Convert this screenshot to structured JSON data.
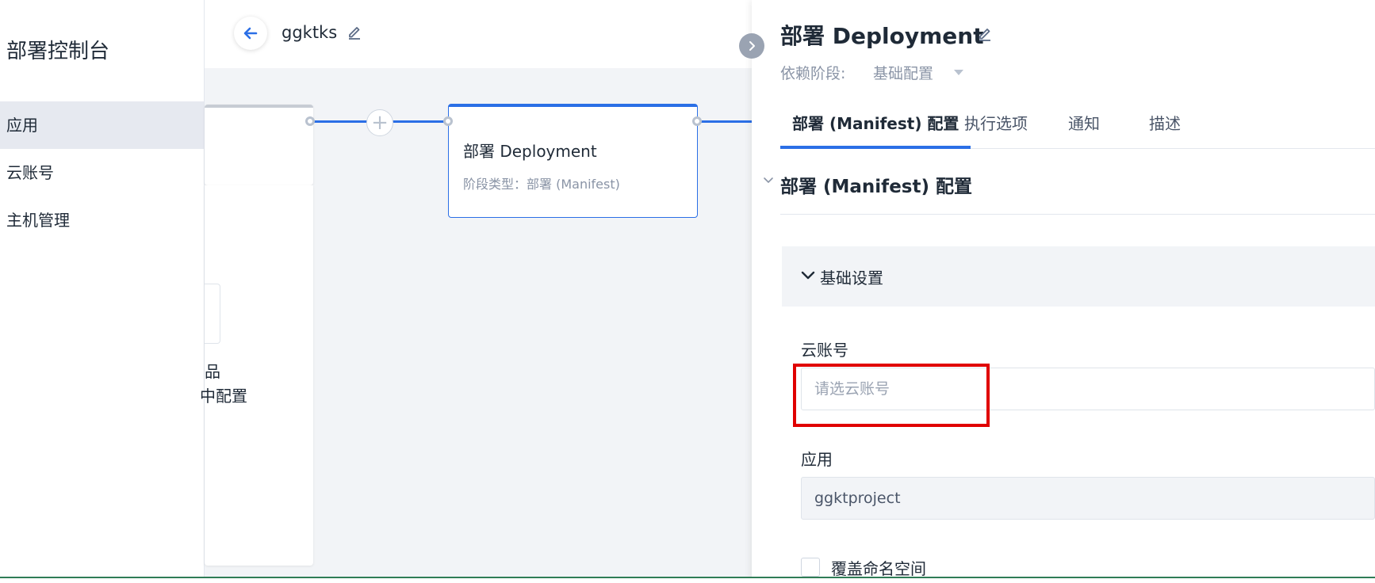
{
  "sidebar": {
    "title": "部署控制台",
    "items": [
      {
        "label": "应用",
        "active": true
      },
      {
        "label": "云账号",
        "active": false
      },
      {
        "label": "主机管理",
        "active": false
      }
    ]
  },
  "header": {
    "pipeline_name": "ggktks"
  },
  "canvas": {
    "prev_card_partial_text_1": "品",
    "prev_card_partial_text_2": "中配置",
    "current_stage": {
      "title": "部署 Deployment",
      "subtitle": "阶段类型：部署 (Manifest)"
    }
  },
  "panel": {
    "title": "部署 Deployment",
    "dependency_label": "依赖阶段:",
    "dependency_value": "基础配置",
    "tabs": [
      {
        "label": "部署 (Manifest) 配置",
        "active": true
      },
      {
        "label": "执行选项",
        "active": false
      },
      {
        "label": "通知",
        "active": false
      },
      {
        "label": "描述",
        "active": false
      }
    ],
    "section_title": "部署 (Manifest) 配置",
    "group_title": "基础设置",
    "cloud_account": {
      "label": "云账号",
      "placeholder": "请选云账号"
    },
    "application": {
      "label": "应用",
      "value": "ggktproject"
    },
    "override_namespace": {
      "label": "覆盖命名空间",
      "checked": false
    }
  },
  "colors": {
    "accent": "#2b6fe6",
    "highlight": "#e00000"
  }
}
